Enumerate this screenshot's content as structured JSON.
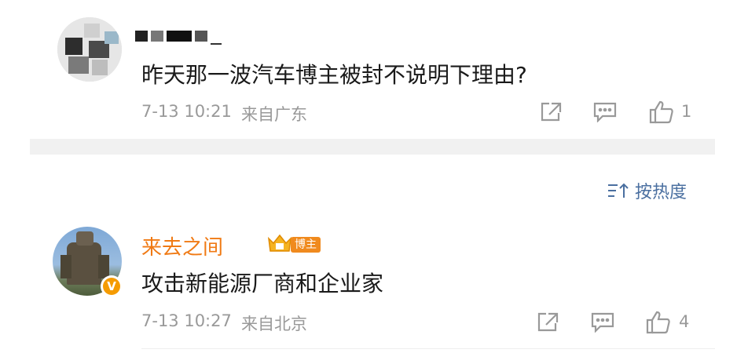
{
  "comments": [
    {
      "text": "昨天那一波汽车博主被封不说明下理由?",
      "time": "7-13 10:21",
      "location": "来自广东",
      "likes": "1",
      "icons": {
        "share": "share-icon",
        "reply": "comment-icon",
        "like": "thumbs-up-icon"
      }
    }
  ],
  "sort": {
    "label": "按热度",
    "icon": "sort-icon"
  },
  "reply": {
    "username": "来去之间",
    "badge": "博主",
    "text": "攻击新能源厂商和企业家",
    "time": "7-13 10:27",
    "location": "来自北京",
    "likes": "4",
    "verified_badge": "V"
  },
  "colors": {
    "username": "#f07a14",
    "meta": "#999999",
    "sort": "#4a6fa0",
    "badge": "#f08a1e"
  }
}
